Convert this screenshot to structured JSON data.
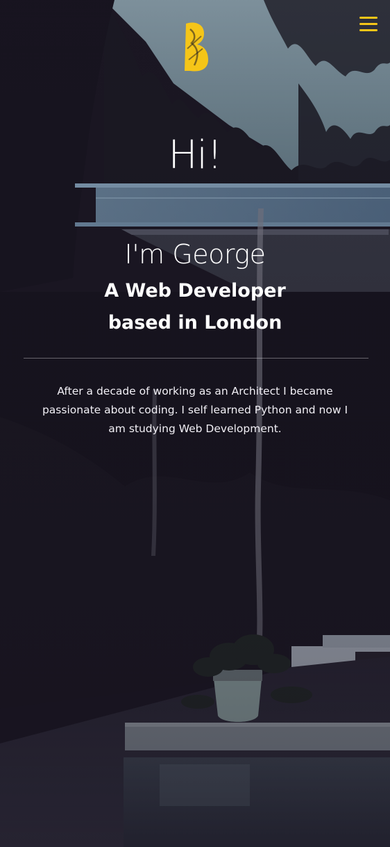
{
  "header": {
    "logo_icon": "brand-logo-icon",
    "menu_icon": "hamburger-menu-icon",
    "accent_color": "#f5c518"
  },
  "hero": {
    "greeting": "Hi!",
    "name": "I'm George",
    "role_line1": "A Web Developer",
    "role_line2": "based in London",
    "bio": "After a decade of working as an Architect I became passionate about coding. I self learned Python and now I am studying Web Development.",
    "background_image": "night-house-forest-photo"
  }
}
